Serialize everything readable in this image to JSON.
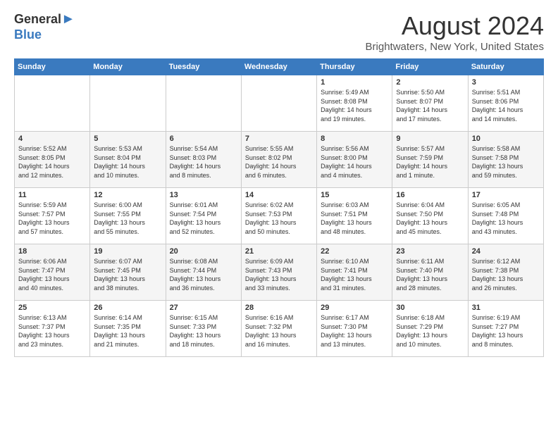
{
  "header": {
    "logo_general": "General",
    "logo_blue": "Blue",
    "month_year": "August 2024",
    "location": "Brightwaters, New York, United States"
  },
  "days_of_week": [
    "Sunday",
    "Monday",
    "Tuesday",
    "Wednesday",
    "Thursday",
    "Friday",
    "Saturday"
  ],
  "weeks": [
    [
      {
        "day": "",
        "content": ""
      },
      {
        "day": "",
        "content": ""
      },
      {
        "day": "",
        "content": ""
      },
      {
        "day": "",
        "content": ""
      },
      {
        "day": "1",
        "content": "Sunrise: 5:49 AM\nSunset: 8:08 PM\nDaylight: 14 hours\nand 19 minutes."
      },
      {
        "day": "2",
        "content": "Sunrise: 5:50 AM\nSunset: 8:07 PM\nDaylight: 14 hours\nand 17 minutes."
      },
      {
        "day": "3",
        "content": "Sunrise: 5:51 AM\nSunset: 8:06 PM\nDaylight: 14 hours\nand 14 minutes."
      }
    ],
    [
      {
        "day": "4",
        "content": "Sunrise: 5:52 AM\nSunset: 8:05 PM\nDaylight: 14 hours\nand 12 minutes."
      },
      {
        "day": "5",
        "content": "Sunrise: 5:53 AM\nSunset: 8:04 PM\nDaylight: 14 hours\nand 10 minutes."
      },
      {
        "day": "6",
        "content": "Sunrise: 5:54 AM\nSunset: 8:03 PM\nDaylight: 14 hours\nand 8 minutes."
      },
      {
        "day": "7",
        "content": "Sunrise: 5:55 AM\nSunset: 8:02 PM\nDaylight: 14 hours\nand 6 minutes."
      },
      {
        "day": "8",
        "content": "Sunrise: 5:56 AM\nSunset: 8:00 PM\nDaylight: 14 hours\nand 4 minutes."
      },
      {
        "day": "9",
        "content": "Sunrise: 5:57 AM\nSunset: 7:59 PM\nDaylight: 14 hours\nand 1 minute."
      },
      {
        "day": "10",
        "content": "Sunrise: 5:58 AM\nSunset: 7:58 PM\nDaylight: 13 hours\nand 59 minutes."
      }
    ],
    [
      {
        "day": "11",
        "content": "Sunrise: 5:59 AM\nSunset: 7:57 PM\nDaylight: 13 hours\nand 57 minutes."
      },
      {
        "day": "12",
        "content": "Sunrise: 6:00 AM\nSunset: 7:55 PM\nDaylight: 13 hours\nand 55 minutes."
      },
      {
        "day": "13",
        "content": "Sunrise: 6:01 AM\nSunset: 7:54 PM\nDaylight: 13 hours\nand 52 minutes."
      },
      {
        "day": "14",
        "content": "Sunrise: 6:02 AM\nSunset: 7:53 PM\nDaylight: 13 hours\nand 50 minutes."
      },
      {
        "day": "15",
        "content": "Sunrise: 6:03 AM\nSunset: 7:51 PM\nDaylight: 13 hours\nand 48 minutes."
      },
      {
        "day": "16",
        "content": "Sunrise: 6:04 AM\nSunset: 7:50 PM\nDaylight: 13 hours\nand 45 minutes."
      },
      {
        "day": "17",
        "content": "Sunrise: 6:05 AM\nSunset: 7:48 PM\nDaylight: 13 hours\nand 43 minutes."
      }
    ],
    [
      {
        "day": "18",
        "content": "Sunrise: 6:06 AM\nSunset: 7:47 PM\nDaylight: 13 hours\nand 40 minutes."
      },
      {
        "day": "19",
        "content": "Sunrise: 6:07 AM\nSunset: 7:45 PM\nDaylight: 13 hours\nand 38 minutes."
      },
      {
        "day": "20",
        "content": "Sunrise: 6:08 AM\nSunset: 7:44 PM\nDaylight: 13 hours\nand 36 minutes."
      },
      {
        "day": "21",
        "content": "Sunrise: 6:09 AM\nSunset: 7:43 PM\nDaylight: 13 hours\nand 33 minutes."
      },
      {
        "day": "22",
        "content": "Sunrise: 6:10 AM\nSunset: 7:41 PM\nDaylight: 13 hours\nand 31 minutes."
      },
      {
        "day": "23",
        "content": "Sunrise: 6:11 AM\nSunset: 7:40 PM\nDaylight: 13 hours\nand 28 minutes."
      },
      {
        "day": "24",
        "content": "Sunrise: 6:12 AM\nSunset: 7:38 PM\nDaylight: 13 hours\nand 26 minutes."
      }
    ],
    [
      {
        "day": "25",
        "content": "Sunrise: 6:13 AM\nSunset: 7:37 PM\nDaylight: 13 hours\nand 23 minutes."
      },
      {
        "day": "26",
        "content": "Sunrise: 6:14 AM\nSunset: 7:35 PM\nDaylight: 13 hours\nand 21 minutes."
      },
      {
        "day": "27",
        "content": "Sunrise: 6:15 AM\nSunset: 7:33 PM\nDaylight: 13 hours\nand 18 minutes."
      },
      {
        "day": "28",
        "content": "Sunrise: 6:16 AM\nSunset: 7:32 PM\nDaylight: 13 hours\nand 16 minutes."
      },
      {
        "day": "29",
        "content": "Sunrise: 6:17 AM\nSunset: 7:30 PM\nDaylight: 13 hours\nand 13 minutes."
      },
      {
        "day": "30",
        "content": "Sunrise: 6:18 AM\nSunset: 7:29 PM\nDaylight: 13 hours\nand 10 minutes."
      },
      {
        "day": "31",
        "content": "Sunrise: 6:19 AM\nSunset: 7:27 PM\nDaylight: 13 hours\nand 8 minutes."
      }
    ]
  ]
}
